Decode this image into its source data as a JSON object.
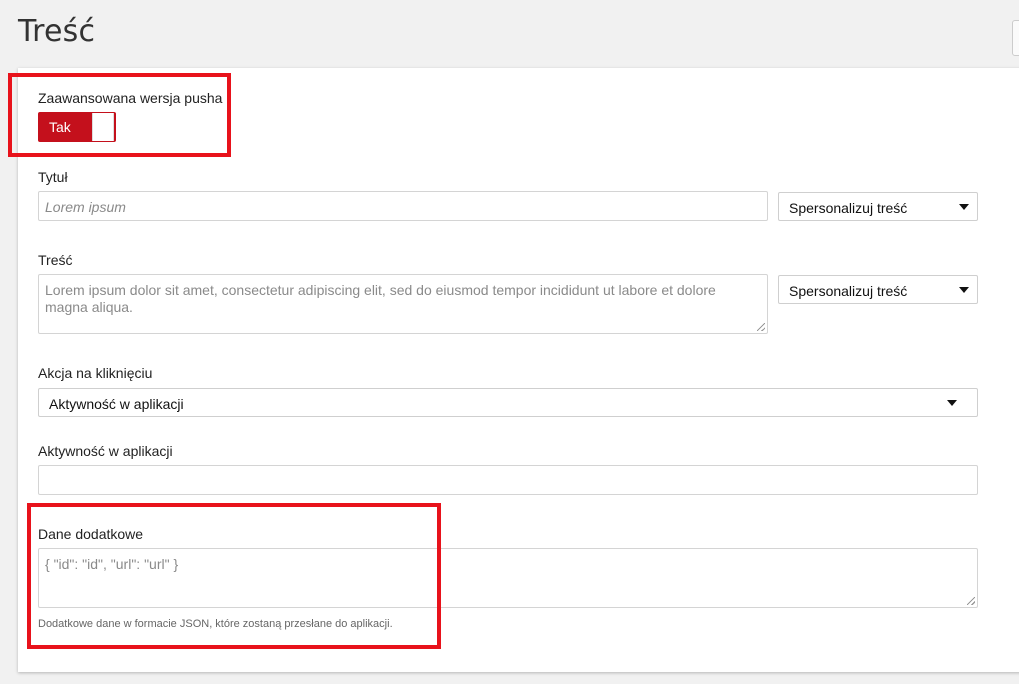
{
  "page": {
    "title": "Treść"
  },
  "advanced": {
    "label": "Zaawansowana wersja pusha",
    "toggle_value": "Tak"
  },
  "title_field": {
    "label": "Tytuł",
    "placeholder": "Lorem ipsum",
    "personalize": "Spersonalizuj treść"
  },
  "content_field": {
    "label": "Treść",
    "placeholder": "Lorem ipsum dolor sit amet, consectetur adipiscing elit, sed do eiusmod tempor incididunt ut labore et dolore magna aliqua.",
    "personalize": "Spersonalizuj treść"
  },
  "click_action": {
    "label": "Akcja na kliknięciu",
    "value": "Aktywność w aplikacji"
  },
  "app_activity": {
    "label": "Aktywność w aplikacji",
    "value": ""
  },
  "extra_data": {
    "label": "Dane dodatkowe",
    "placeholder": "{ \"id\": \"id\", \"url\": \"url\" }",
    "help": "Dodatkowe dane w formacie JSON, które zostaną przesłane do aplikacji."
  },
  "colors": {
    "accent": "#c4101c",
    "highlight": "#e8121b"
  }
}
